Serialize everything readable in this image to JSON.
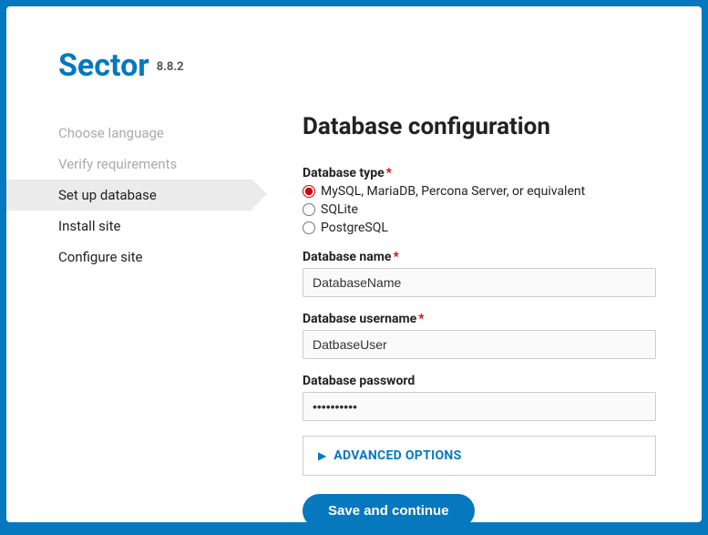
{
  "brand": {
    "title": "Sector",
    "version": "8.8.2"
  },
  "sidebar": {
    "items": [
      {
        "label": "Choose language",
        "state": "completed"
      },
      {
        "label": "Verify requirements",
        "state": "completed"
      },
      {
        "label": "Set up database",
        "state": "active"
      },
      {
        "label": "Install site",
        "state": "upcoming"
      },
      {
        "label": "Configure site",
        "state": "upcoming"
      }
    ]
  },
  "main": {
    "title": "Database configuration",
    "db_type": {
      "label": "Database type",
      "required_mark": "*",
      "options": [
        {
          "label": "MySQL, MariaDB, Percona Server, or equivalent",
          "checked": true
        },
        {
          "label": "SQLite",
          "checked": false
        },
        {
          "label": "PostgreSQL",
          "checked": false
        }
      ]
    },
    "db_name": {
      "label": "Database name",
      "required_mark": "*",
      "value": "DatabaseName"
    },
    "db_user": {
      "label": "Database username",
      "required_mark": "*",
      "value": "DatbaseUser"
    },
    "db_pass": {
      "label": "Database password",
      "value": "••••••••••"
    },
    "advanced": {
      "label": "ADVANCED OPTIONS",
      "arrow": "▶"
    },
    "submit": {
      "label": "Save and continue"
    }
  }
}
